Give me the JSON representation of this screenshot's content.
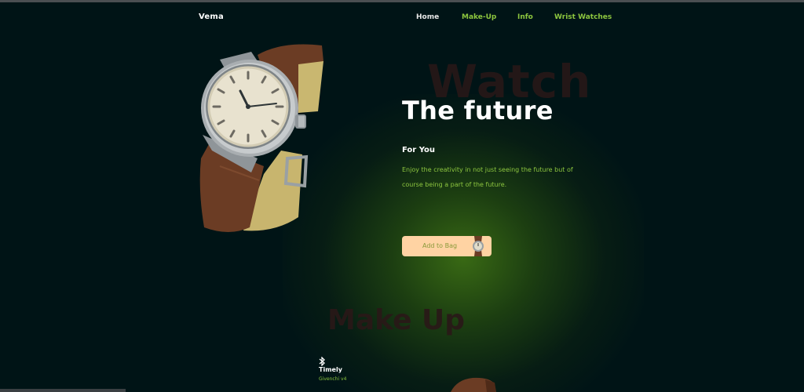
{
  "brand": {
    "logo": "Vema"
  },
  "nav": {
    "items": [
      "Home",
      "Make-Up",
      "Info",
      "Wrist Watches"
    ]
  },
  "hero": {
    "background_word": "Watch",
    "headline": "The future",
    "subtitle": "For You",
    "description": "Enjoy the creativity in not just seeing the future but of course being a part of the future.",
    "cta_label": "Add to Bag"
  },
  "makeup": {
    "background_word": "Make Up",
    "product_name": "Timely",
    "product_brand": "Givenchi v4"
  },
  "colors": {
    "background": "#001416",
    "accent": "#8dc63f",
    "button": "#ffd3a3",
    "glow": "#3c6e14"
  },
  "icons": {
    "product_icon": "bluetooth-icon"
  }
}
